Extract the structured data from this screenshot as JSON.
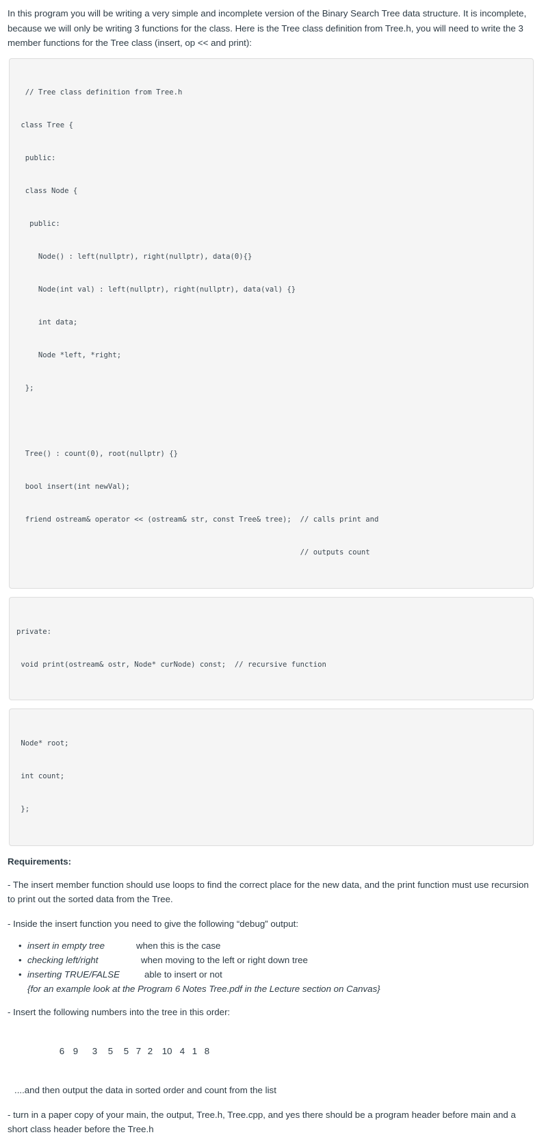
{
  "intro": {
    "paragraph": "In this program you will be writing a very simple and incomplete version of the Binary Search Tree data structure.  It is incomplete, because we will only be writing 3 functions for the class.  Here is the Tree class definition from Tree.h, you will need to write the 3 member functions for the Tree class (insert, op << and print):"
  },
  "code_blocks": [
    {
      "name": "tree-class-definition",
      "lines": [
        "  // Tree class definition from Tree.h",
        " class Tree {",
        "  public:",
        "  class Node {",
        "   public:",
        "     Node() : left(nullptr), right(nullptr), data(0){}",
        "     Node(int val) : left(nullptr), right(nullptr), data(val) {}",
        "     int data;",
        "     Node *left, *right;",
        "  };",
        "",
        "  Tree() : count(0), root(nullptr) {}",
        "  bool insert(int newVal);",
        "  friend ostream& operator << (ostream& str, const Tree& tree);  // calls print and",
        "                                                                 // outputs count"
      ]
    },
    {
      "name": "private-print-declaration",
      "lines": [
        "private:",
        " void print(ostream& ostr, Node* curNode) const;  // recursive function"
      ]
    },
    {
      "name": "private-members",
      "lines": [
        " Node* root;",
        " int count;",
        " };"
      ]
    }
  ],
  "requirements": {
    "heading": "Requirements:",
    "item_1": "- The insert member function should use loops to find the correct place for the new data, and the print function must use recursion to print out the sorted data from the Tree.",
    "item_2": "- Inside the insert function you need to give the following “debug” output:",
    "debug_output": [
      {
        "term": "insert in empty tree",
        "desc": "when this is the case"
      },
      {
        "term": "checking left/right",
        "desc": "when moving to the left or right down tree"
      },
      {
        "term": "inserting TRUE/FALSE",
        "desc": "able to insert or not"
      }
    ],
    "example_note": "{for an example look at the Program 6 Notes Tree.pdf in the Lecture section on Canvas}",
    "item_3": "- Insert the following numbers into the tree in this order:",
    "numbers": [
      "6",
      "9",
      "3",
      "5",
      "5",
      "7",
      "2",
      "10",
      "4",
      "1",
      "8"
    ],
    "item_4": "....and then output the data in sorted order and count from the list",
    "item_5": "- turn in a paper copy of your main, the output, Tree.h, Tree.cpp, and yes there should be a program header before main and a short class header before the Tree.h"
  },
  "colors": {
    "text": "#2d3b45",
    "code_text": "#3c4852",
    "code_background": "#f5f5f5",
    "code_border": "#dddddd",
    "page_background": "#ffffff"
  }
}
